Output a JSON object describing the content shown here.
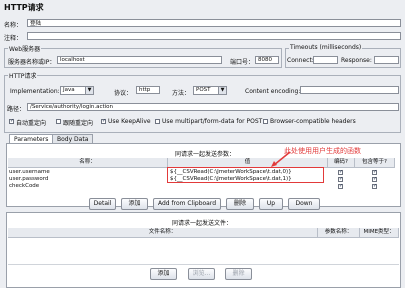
{
  "title": "HTTP请求",
  "name_label": "名称：",
  "name_value": "登陆",
  "comment_label": "注释：",
  "web_server": {
    "title": "Web服务器",
    "host_label": "服务器名称或IP：",
    "host_value": "localhost",
    "port_label": "端口号：",
    "port_value": "8080"
  },
  "timeouts": {
    "title": "Timeouts (milliseconds)",
    "connect_label": "Connect:",
    "response_label": "Response:"
  },
  "http_request": {
    "title": "HTTP请求",
    "impl_label": "Implementation:",
    "impl_value": "Java",
    "protocol_label": "协议：",
    "protocol_value": "http",
    "method_label": "方法：",
    "method_value": "POST",
    "encoding_label": "Content encoding:",
    "path_label": "路径：",
    "path_value": "/Service/authority/login.action",
    "checkboxes": [
      {
        "label": "自动重定向",
        "checked": true
      },
      {
        "label": "跟随重定向",
        "checked": false
      },
      {
        "label": "Use KeepAlive",
        "checked": true
      },
      {
        "label": "Use multipart/form-data for POST",
        "checked": false
      },
      {
        "label": "Browser-compatible headers",
        "checked": false
      }
    ]
  },
  "tabs": {
    "parameters": "Parameters",
    "body": "Body Data"
  },
  "params_table": {
    "caption": "同请求一起发送参数：",
    "col_name": "名称：",
    "col_value": "值",
    "col_encode": "编码?",
    "col_include": "包含等于?",
    "rows": [
      {
        "name": "user.username",
        "value": "${__CSVRead(C:\\JmeterWorkSpace\\t.dat,0)}"
      },
      {
        "name": "user.password",
        "value": "${__CSVRead(C:\\JmeterWorkSpace\\t.dat,1)}"
      },
      {
        "name": "checkCode",
        "value": ""
      }
    ]
  },
  "annotation": "此处使用用户生成的函数",
  "param_buttons": {
    "detail": "Detail",
    "add": "添加",
    "clipboard": "Add from Clipboard",
    "delete": "删除",
    "up": "Up",
    "down": "Down"
  },
  "files_table": {
    "caption": "同请求一起发送文件：",
    "col_path": "文件名称：",
    "col_param": "参数名称：",
    "col_mime": "MIME类型："
  },
  "file_buttons": {
    "add": "添加",
    "browse": "浏览...",
    "delete": "删除"
  }
}
